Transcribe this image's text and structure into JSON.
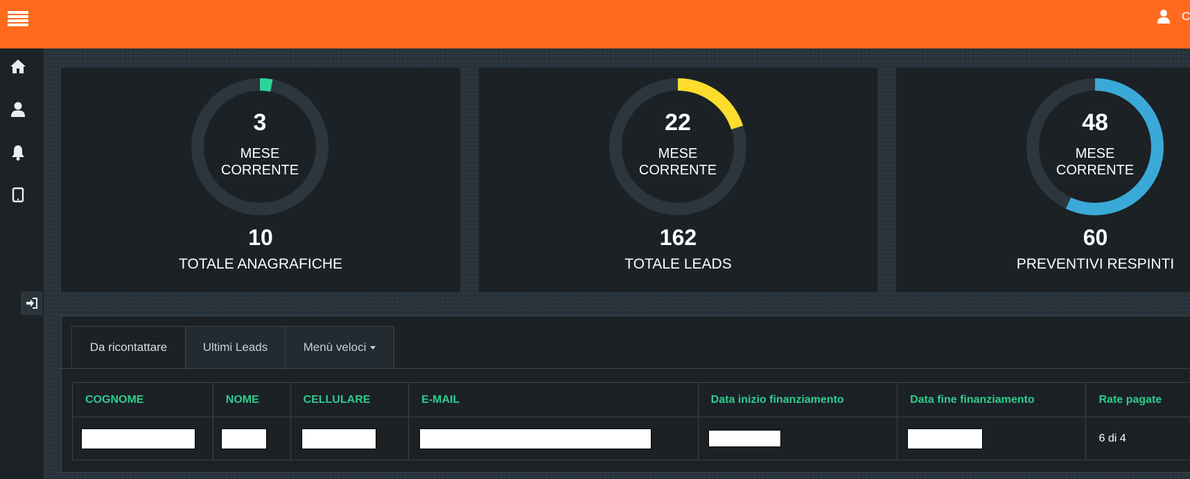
{
  "header": {
    "user_name": "C",
    "menu_icon": "hamburger-menu-icon",
    "user_icon": "user-icon"
  },
  "sidebar": {
    "items": [
      {
        "icon": "home-icon"
      },
      {
        "icon": "user-icon"
      },
      {
        "icon": "bell-icon"
      },
      {
        "icon": "tablet-icon"
      }
    ],
    "logout_icon": "sign-in-icon"
  },
  "colors": {
    "topbar": "#ff6a1f",
    "ring_track": "#2b363f",
    "ring_green": "#2ed39a",
    "ring_yellow": "#fddc2e",
    "ring_blue": "#3aa9d8",
    "header_text": "#2ecc8f"
  },
  "stats": [
    {
      "month_value": "3",
      "caption_line1": "MESE",
      "caption_line2": "CORRENTE",
      "total_value": "10",
      "total_label": "TOTALE ANAGRAFICHE",
      "fraction": 0.03
    },
    {
      "month_value": "22",
      "caption_line1": "MESE",
      "caption_line2": "CORRENTE",
      "total_value": "162",
      "total_label": "TOTALE LEADS",
      "fraction": 0.2
    },
    {
      "month_value": "48",
      "caption_line1": "MESE",
      "caption_line2": "CORRENTE",
      "total_value": "60",
      "total_label": "PREVENTIVI RESPINTI",
      "fraction": 0.57
    }
  ],
  "tabs": [
    {
      "label": "Da ricontattare",
      "active": true
    },
    {
      "label": "Ultimi Leads",
      "active": false
    },
    {
      "label": "Menù veloci",
      "active": false
    }
  ],
  "table": {
    "columns": [
      "COGNOME",
      "NOME",
      "CELLULARE",
      "E-MAIL",
      "Data inizio finanziamento",
      "Data fine finanziamento",
      "Rate pagate"
    ],
    "rows": [
      {
        "rate_pagate": "6 di 4"
      }
    ]
  }
}
